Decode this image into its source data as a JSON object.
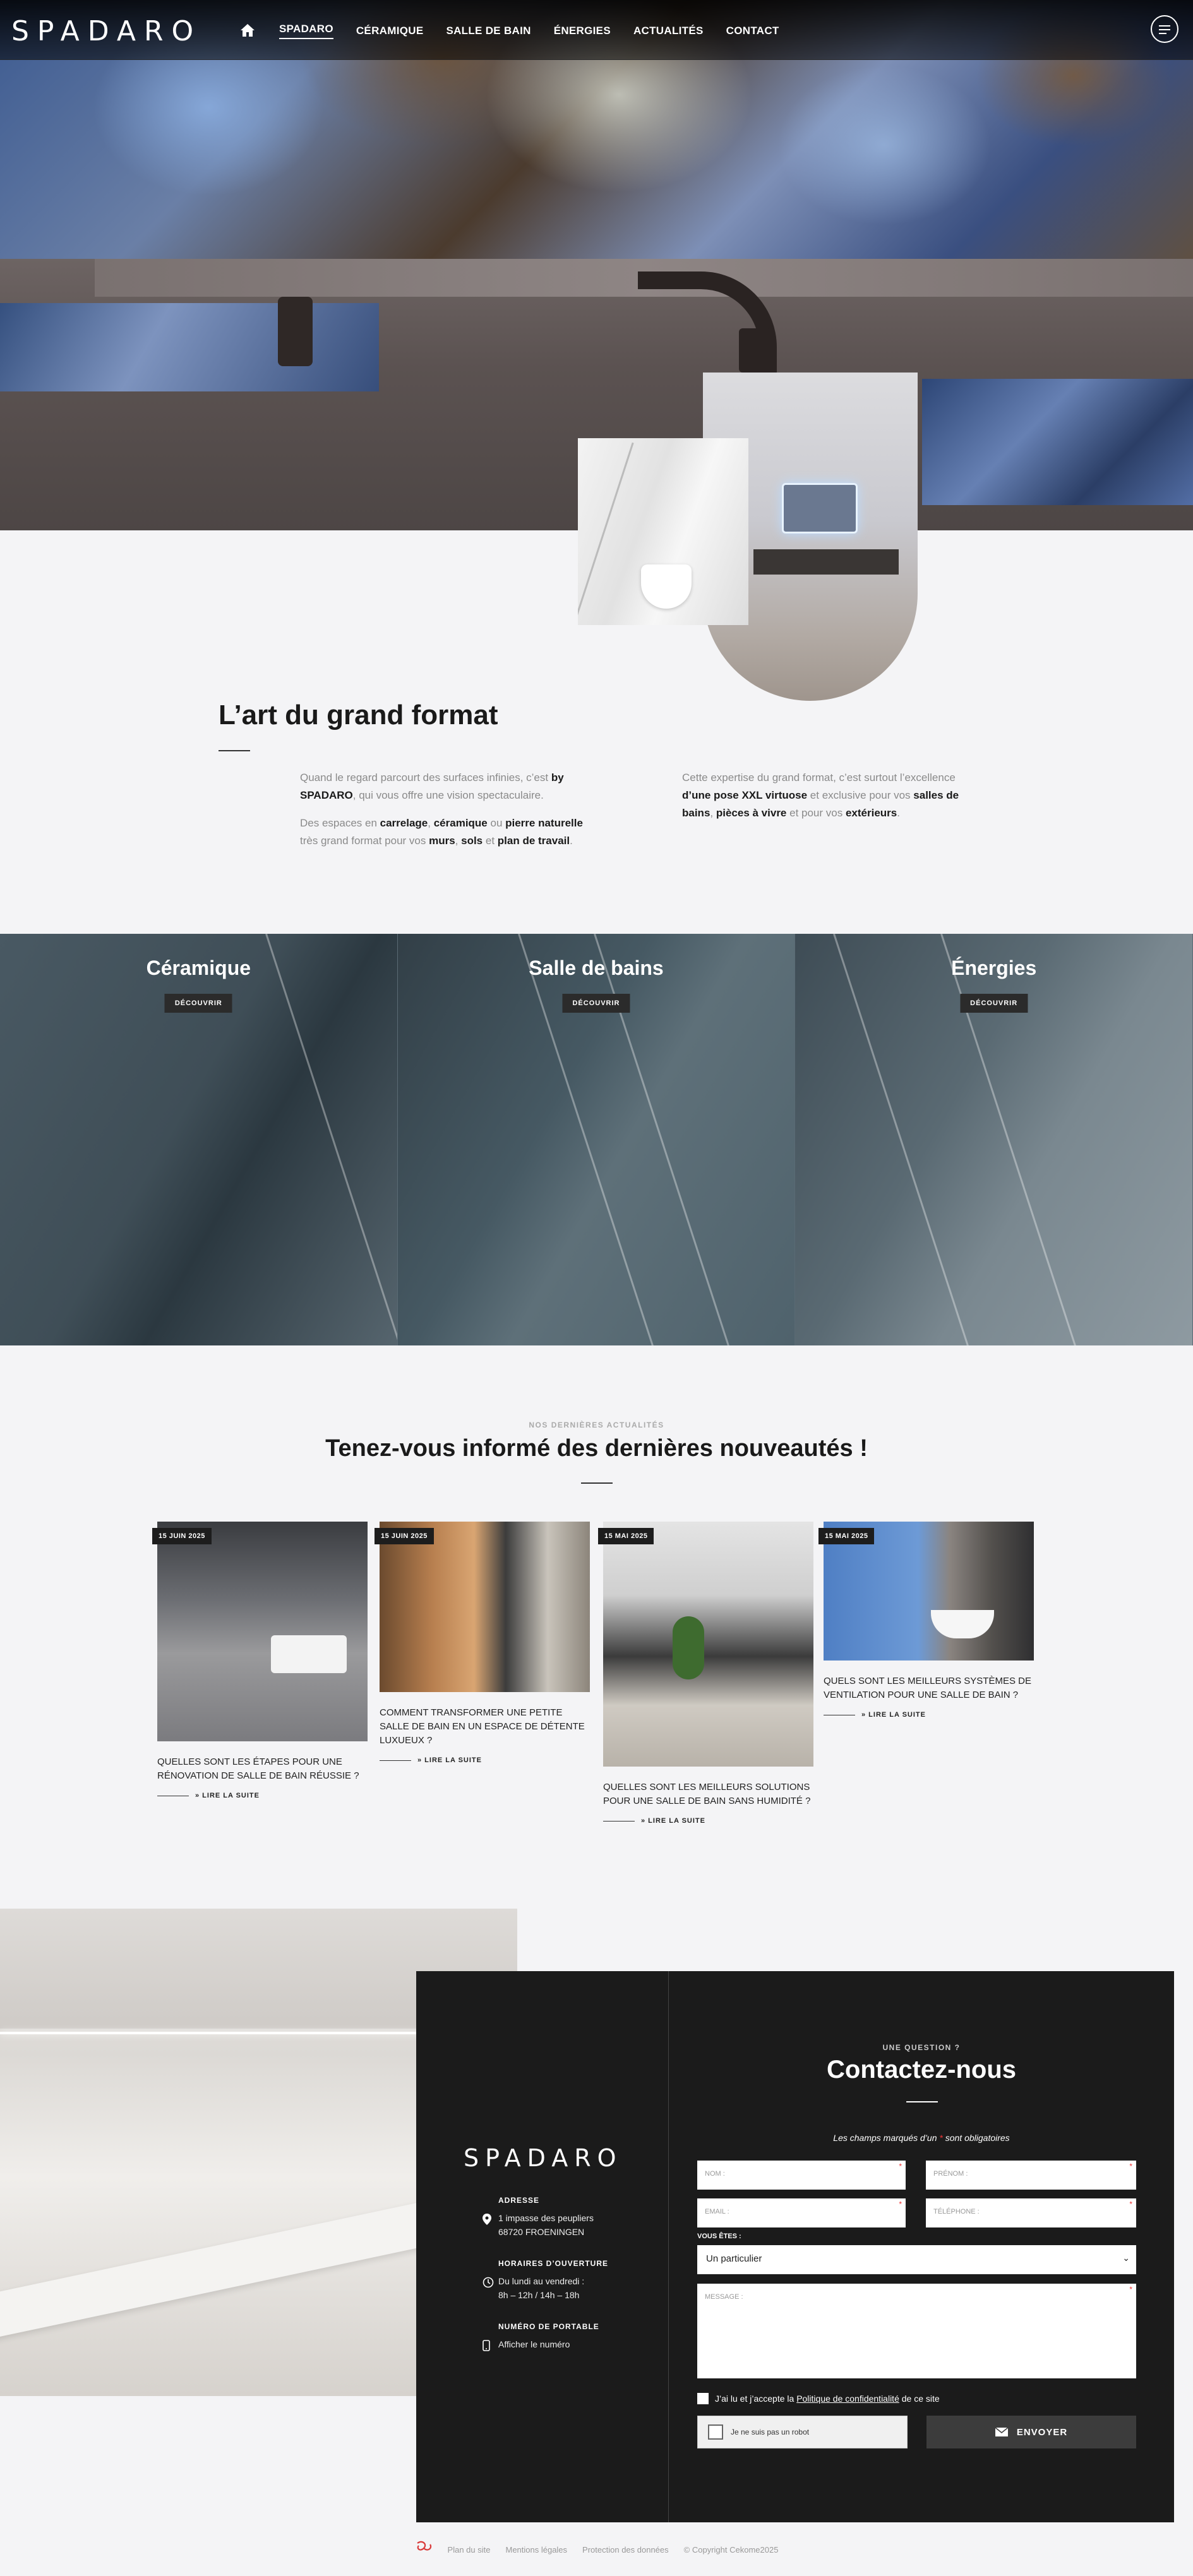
{
  "brand": {
    "logo": "SPADARO"
  },
  "nav": {
    "home_icon": "home-icon",
    "items": [
      {
        "label": "SPADARO",
        "active": true
      },
      {
        "label": "CÉRAMIQUE"
      },
      {
        "label": "SALLE DE BAIN"
      },
      {
        "label": "ÉNERGIES"
      },
      {
        "label": "ACTUALITÉS"
      },
      {
        "label": "CONTACT"
      }
    ],
    "menu_icon": "menu-icon"
  },
  "intro": {
    "title": "L’art du grand format",
    "col1_p1": [
      "Quand le regard parcourt des surfaces infinies, c’est ",
      "by SPADARO",
      ", qui vous offre une vision spectaculaire."
    ],
    "col1_p2": [
      "Des espaces en ",
      "carrelage",
      ", ",
      "céramique",
      " ou ",
      "pierre naturelle",
      " très grand format pour vos ",
      "murs",
      ", ",
      "sols",
      " et ",
      "plan de travail",
      "."
    ],
    "col2_p1": [
      "Cette expertise du grand format, c’est surtout l’excellence ",
      "d’une pose XXL virtuose",
      " et exclusive pour vos ",
      "salles de bains",
      ", ",
      "pièces à vivre",
      " et pour vos ",
      "extérieurs",
      "."
    ]
  },
  "categories": [
    {
      "title": "Céramique",
      "button": "DÉCOUVRIR"
    },
    {
      "title": "Salle de bains",
      "button": "DÉCOUVRIR"
    },
    {
      "title": "Énergies",
      "button": "DÉCOUVRIR"
    }
  ],
  "news": {
    "kicker": "NOS DERNIÈRES ACTUALITÉS",
    "title": "Tenez-vous informé des dernières nouveautés !",
    "read_more": "» LIRE LA SUITE",
    "articles": [
      {
        "date": "15 JUIN 2025",
        "title": "QUELLES SONT LES ÉTAPES POUR UNE RÉNOVATION DE SALLE DE BAIN RÉUSSIE ?"
      },
      {
        "date": "15 JUIN 2025",
        "title": "COMMENT TRANSFORMER UNE PETITE SALLE DE BAIN EN UN ESPACE DE DÉTENTE LUXUEUX ?"
      },
      {
        "date": "15 MAI 2025",
        "title": "QUELLES SONT LES MEILLEURS SOLUTIONS POUR UNE SALLE DE BAIN SANS HUMIDITÉ ?"
      },
      {
        "date": "15 MAI 2025",
        "title": "QUELS SONT LES MEILLEURS SYSTÈMES DE VENTILATION POUR UNE SALLE DE BAIN ?"
      }
    ]
  },
  "contact_info": {
    "logo": "SPADARO",
    "address_label": "ADRESSE",
    "address_line1": "1 impasse des peupliers",
    "address_line2": "68720 FROENINGEN",
    "hours_label": "HORAIRES D’OUVERTURE",
    "hours_line1": "Du lundi au vendredi :",
    "hours_line2": "8h – 12h / 14h – 18h",
    "phone_label": "NUMÉRO DE PORTABLE",
    "phone_value": "Afficher le numéro"
  },
  "contact_form": {
    "kicker": "UNE QUESTION ?",
    "title": "Contactez-nous",
    "required_note_1": "Les champs marqués d’un",
    "required_note_star": "*",
    "required_note_2": "sont obligatoires",
    "nom_placeholder": "NOM :",
    "prenom_placeholder": "PRÉNOM :",
    "email_placeholder": "EMAIL :",
    "telephone_placeholder": "TÉLÉPHONE :",
    "vous_etes_label": "VOUS ÊTES :",
    "vous_etes_value": "Un particulier",
    "message_placeholder": "MESSAGE :",
    "consent_1": "J’ai lu et j’accepte la",
    "consent_link": "Politique de confidentialité",
    "consent_2": "de ce site",
    "captcha_label": "Je ne suis pas un robot",
    "submit_label": "ENVOYER"
  },
  "footer": {
    "links": [
      "Plan du site",
      "Mentions légales",
      "Protection des données"
    ],
    "copyright": "© Copyright Cekome2025"
  }
}
